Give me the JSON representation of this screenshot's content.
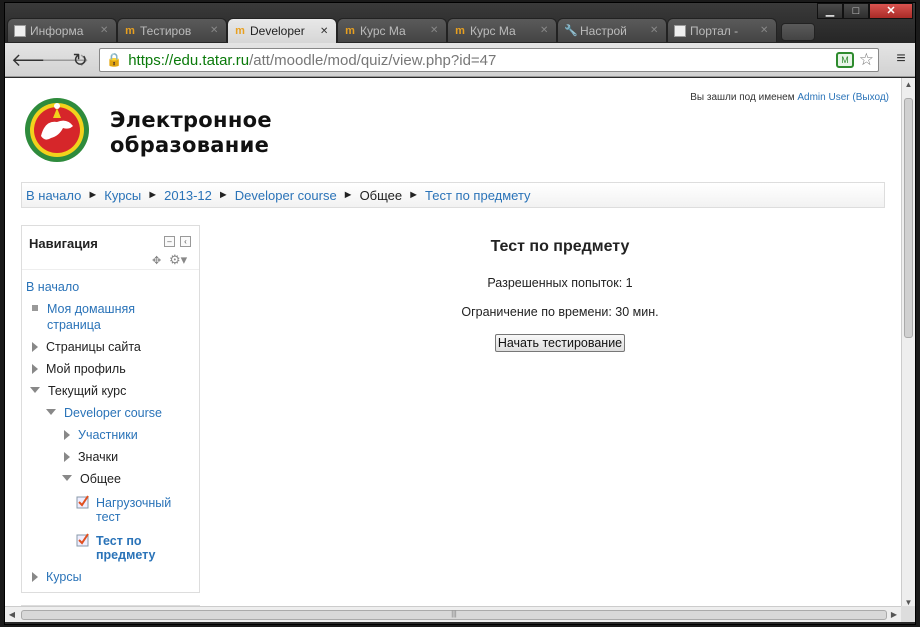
{
  "browser": {
    "window_controls": {
      "minimize": "▁",
      "maximize": "□",
      "close": "✕"
    },
    "tabs": [
      {
        "label": "Информа",
        "icon": "page-icon",
        "active": false
      },
      {
        "label": "Тестиров",
        "icon": "moodle-icon",
        "active": false
      },
      {
        "label": "Developer",
        "icon": "moodle-icon",
        "active": true
      },
      {
        "label": "Курс Ма",
        "icon": "moodle-icon",
        "active": false
      },
      {
        "label": "Курс Ма",
        "icon": "moodle-icon",
        "active": false
      },
      {
        "label": "Настрой",
        "icon": "wrench-icon",
        "active": false
      },
      {
        "label": "Портал -",
        "icon": "page-icon",
        "active": false
      }
    ],
    "url": {
      "scheme": "https://",
      "host": "edu.tatar.ru",
      "path": "/att/moodle/mod/quiz/view.php?id=47"
    }
  },
  "header": {
    "brand_line1": "Электронное",
    "brand_line2": "образование",
    "login_prefix": "Вы зашли под именем",
    "login_user": "Admin User",
    "logout_label": "(Выход)"
  },
  "breadcrumb": {
    "items": [
      "В начало",
      "Курсы",
      "2013-12",
      "Developer course",
      "Общее",
      "Тест по предмету"
    ],
    "separator": "►"
  },
  "navigation": {
    "title": "Навигация",
    "home": "В начало",
    "my_home_line1": "Моя домашняя",
    "my_home_line2": "страница",
    "site_pages": "Страницы сайта",
    "my_profile": "Мой профиль",
    "current_course": "Текущий курс",
    "course": "Developer course",
    "participants": "Участники",
    "badges": "Значки",
    "general": "Общее",
    "quiz1_line1": "Нагрузочный",
    "quiz1_line2": "тест",
    "quiz2_line1": "Тест по",
    "quiz2_line2": "предмету",
    "courses": "Курсы"
  },
  "main": {
    "title": "Тест по предмету",
    "attempts": "Разрешенных попыток: 1",
    "time_limit": "Ограничение по времени: 30 мин.",
    "start_button": "Начать тестирование"
  },
  "colors": {
    "link": "#2a73b8",
    "url_host": "#0a7a0a",
    "logo_red": "#d6262a",
    "logo_green": "#2e8b3c"
  }
}
